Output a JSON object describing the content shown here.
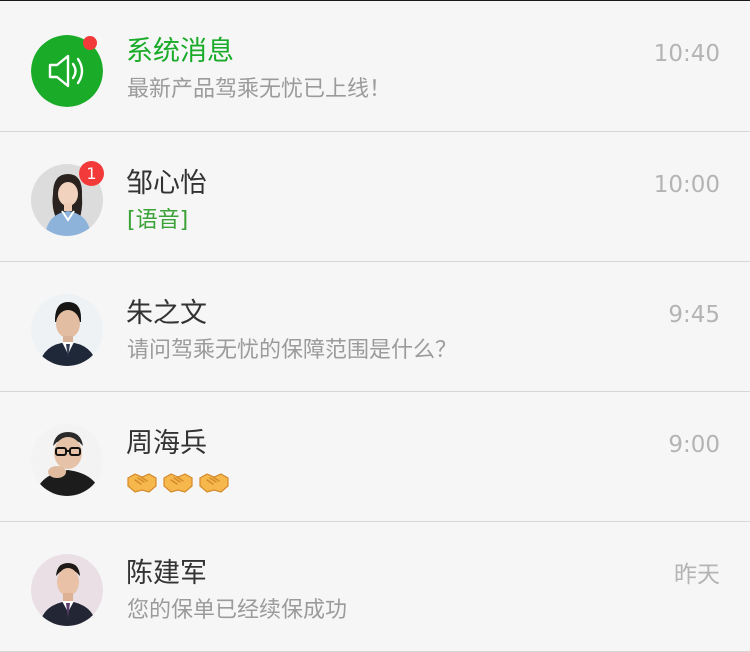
{
  "conversations": [
    {
      "name": "系统消息",
      "preview": "最新产品驾乘无忧已上线！",
      "time": "10:40",
      "avatar_icon": "speaker-icon",
      "has_unread_dot": true,
      "accent_color": "#1aab29"
    },
    {
      "name": "邹心怡",
      "preview": "[语音]",
      "time": "10:00",
      "unread_count": "1",
      "avatar_icon": "avatar-photo"
    },
    {
      "name": "朱之文",
      "preview": "请问驾乘无忧的保障范围是什么？",
      "time": "9:45",
      "avatar_icon": "avatar-photo"
    },
    {
      "name": "周海兵",
      "preview_emoji": [
        "handshake-emoji",
        "handshake-emoji",
        "handshake-emoji"
      ],
      "time": "9:00",
      "avatar_icon": "avatar-photo"
    },
    {
      "name": "陈建军",
      "preview": "您的保单已经续保成功",
      "time": "昨天",
      "avatar_icon": "avatar-photo"
    }
  ],
  "colors": {
    "background": "#f6f6f6",
    "divider": "#d7d7d7",
    "badge": "#f23a3a",
    "system_green": "#1aab29",
    "voice_green": "#3aa236"
  }
}
